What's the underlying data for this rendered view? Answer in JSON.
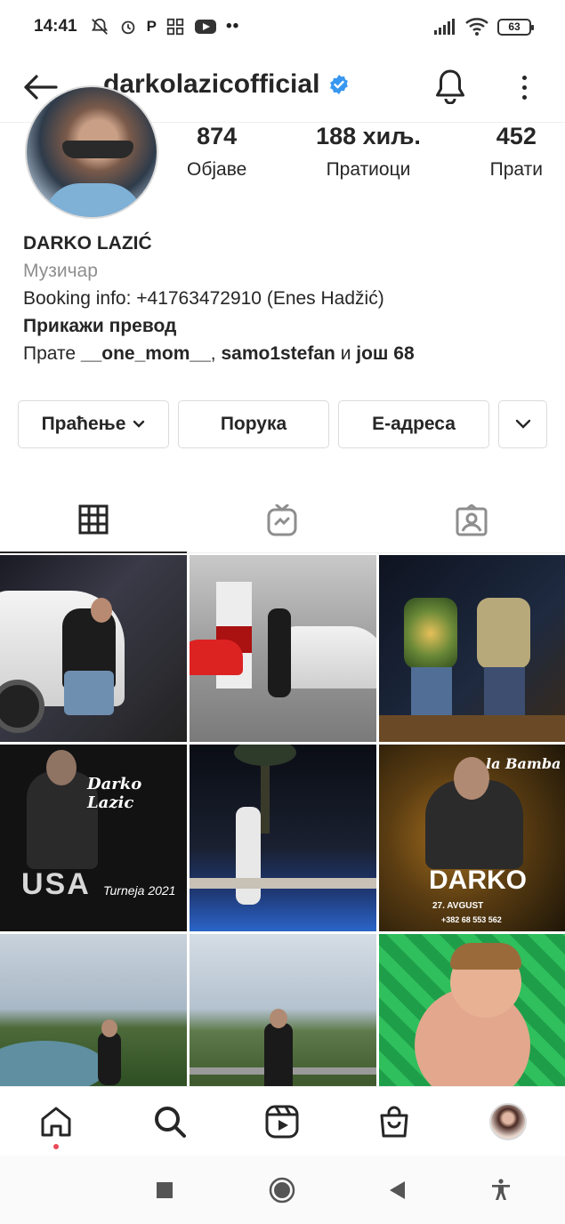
{
  "status_bar": {
    "time": "14:41",
    "left_icons": [
      "notifications-off-icon",
      "alarm-icon",
      "parking-icon",
      "apps-icon",
      "youtube-icon",
      "more-dots-icon"
    ],
    "right_icons": [
      "signal-icon",
      "wifi-icon",
      "battery-icon"
    ],
    "battery": "63"
  },
  "header": {
    "username": "darkolazicofficial",
    "verified": true,
    "icons": [
      "back-arrow-icon",
      "verified-badge-icon",
      "bell-icon",
      "more-vertical-icon"
    ]
  },
  "profile": {
    "stats": [
      {
        "value": "874",
        "label": "Објаве"
      },
      {
        "value": "188 хиљ.",
        "label": "Пратиоци"
      },
      {
        "value": "452",
        "label": "Прати"
      }
    ],
    "name": "DARKO LAZIĆ",
    "category": "Музичар",
    "booking": "Booking info: +41763472910 (Enes Hadžić)",
    "translate": "Прикажи превод",
    "followed_by_prefix": "Прате ",
    "followed_by_user1": "__one_mom__",
    "followed_by_sep": ", ",
    "followed_by_user2": "samo1stefan",
    "followed_by_and": " и ",
    "followed_by_more": "још 68"
  },
  "actions": {
    "following": "Праћење",
    "message": "Порука",
    "email": "Е-адреса"
  },
  "tabs": [
    "grid-icon",
    "igtv-icon",
    "tagged-icon"
  ],
  "grid": {
    "posts": [
      {
        "id": 1,
        "kind": "car-white"
      },
      {
        "id": 2,
        "kind": "garage-cars"
      },
      {
        "id": 3,
        "kind": "two-men-club"
      },
      {
        "id": 4,
        "kind": "usa-poster",
        "title": "Darko Lazic",
        "text1": "USA",
        "text2": "Turneja 2021"
      },
      {
        "id": 5,
        "kind": "pool-night"
      },
      {
        "id": 6,
        "kind": "labamba-poster",
        "title": "la Bamba",
        "text1": "DARKO",
        "text2": "27. AVGUST",
        "text3": "+382 68 553 562"
      },
      {
        "id": 7,
        "kind": "canyon-1"
      },
      {
        "id": 8,
        "kind": "canyon-2"
      },
      {
        "id": 9,
        "kind": "child-mat"
      }
    ]
  },
  "colors": {
    "text": "#262626",
    "muted": "#8e8e8e",
    "verified_blue": "#3897f0",
    "border": "#dbdbdb",
    "notification_dot": "#ed4956"
  },
  "bottom_nav": [
    "home-icon",
    "search-icon",
    "reels-icon",
    "shop-icon",
    "profile-avatar"
  ],
  "system_nav": [
    "recents-square-icon",
    "home-circle-icon",
    "back-triangle-icon",
    "accessibility-icon"
  ]
}
